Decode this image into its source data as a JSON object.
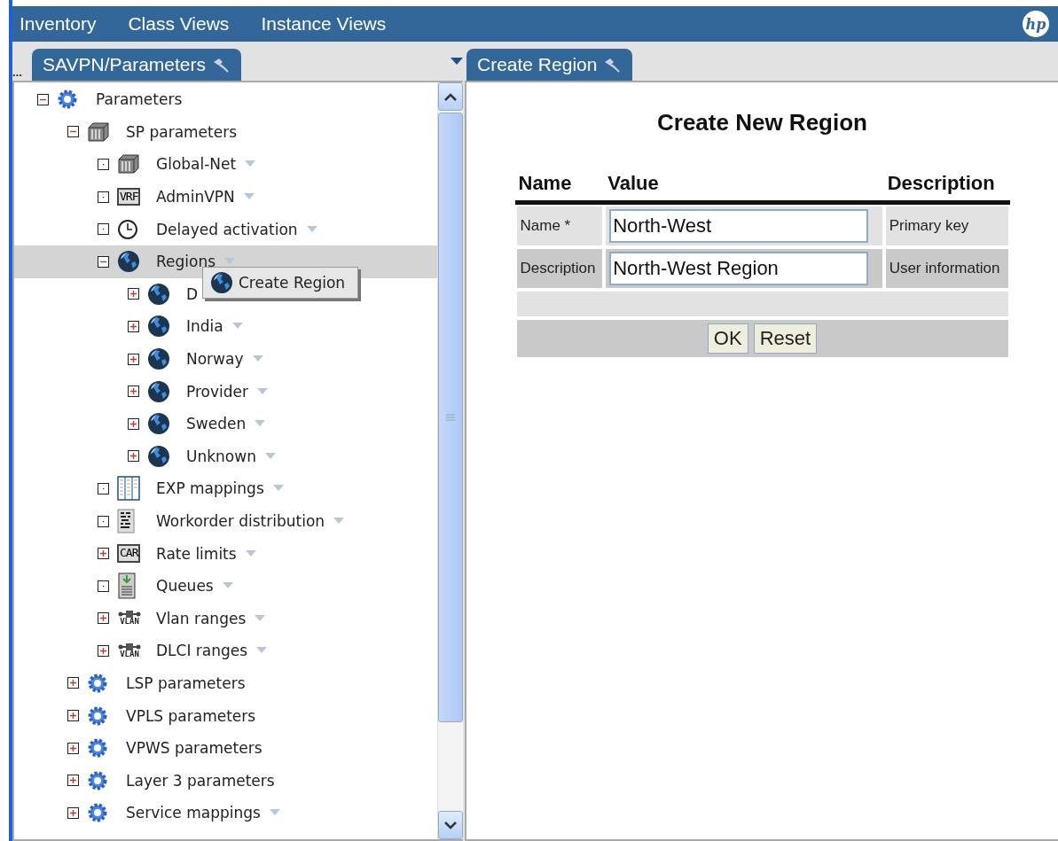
{
  "menu_bar": {
    "items": [
      {
        "label": "Inventory"
      },
      {
        "label": "Class Views"
      },
      {
        "label": "Instance Views"
      }
    ],
    "logo": "hp"
  },
  "left_pane": {
    "overflow_marker": "…",
    "tab": {
      "label": "SAVPN/Parameters",
      "selected": true
    },
    "tree": [
      {
        "label": "Parameters",
        "kind": "gear",
        "expandable": true,
        "expanded": true,
        "menu": false,
        "selected": false,
        "children": [
          {
            "label": "SP parameters",
            "kind": "cube",
            "expandable": true,
            "expanded": true,
            "menu": false,
            "selected": false,
            "children": [
              {
                "label": "Global-Net",
                "kind": "cube",
                "expandable": false,
                "menu": true,
                "selected": false
              },
              {
                "label": "AdminVPN",
                "kind": "tag",
                "icon_text": "VRF",
                "expandable": false,
                "menu": true,
                "selected": false
              },
              {
                "label": "Delayed activation",
                "kind": "clock",
                "expandable": false,
                "menu": true,
                "selected": false
              },
              {
                "label": "Regions",
                "kind": "globe",
                "expandable": true,
                "expanded": true,
                "menu": true,
                "selected": true,
                "children": [
                  {
                    "label": "D",
                    "kind": "globe",
                    "expandable": true,
                    "expanded": false,
                    "menu": false,
                    "selected": false
                  },
                  {
                    "label": "India",
                    "kind": "globe",
                    "expandable": true,
                    "expanded": false,
                    "menu": true,
                    "selected": false
                  },
                  {
                    "label": "Norway",
                    "kind": "globe",
                    "expandable": true,
                    "expanded": false,
                    "menu": true,
                    "selected": false
                  },
                  {
                    "label": "Provider",
                    "kind": "globe",
                    "expandable": true,
                    "expanded": false,
                    "menu": true,
                    "selected": false
                  },
                  {
                    "label": "Sweden",
                    "kind": "globe",
                    "expandable": true,
                    "expanded": false,
                    "menu": true,
                    "selected": false
                  },
                  {
                    "label": "Unknown",
                    "kind": "globe",
                    "expandable": true,
                    "expanded": false,
                    "menu": true,
                    "selected": false
                  }
                ]
              },
              {
                "label": "EXP mappings",
                "kind": "columns",
                "expandable": false,
                "menu": true,
                "selected": false
              },
              {
                "label": "Workorder distribution",
                "kind": "document",
                "expandable": false,
                "menu": true,
                "selected": false
              },
              {
                "label": "Rate limits",
                "kind": "tag",
                "icon_text": "CAR",
                "expandable": true,
                "expanded": false,
                "menu": true,
                "selected": false
              },
              {
                "label": "Queues",
                "kind": "queue",
                "expandable": false,
                "menu": true,
                "selected": false
              },
              {
                "label": "Vlan ranges",
                "kind": "connector",
                "icon_text": "VLAN",
                "expandable": true,
                "expanded": false,
                "menu": true,
                "selected": false
              },
              {
                "label": "DLCI ranges",
                "kind": "connector",
                "icon_text": "VLAN",
                "expandable": true,
                "expanded": false,
                "menu": true,
                "selected": false
              }
            ]
          },
          {
            "label": "LSP parameters",
            "kind": "gear",
            "expandable": true,
            "expanded": false,
            "menu": false,
            "selected": false
          },
          {
            "label": "VPLS parameters",
            "kind": "gear",
            "expandable": true,
            "expanded": false,
            "menu": false,
            "selected": false
          },
          {
            "label": "VPWS parameters",
            "kind": "gear",
            "expandable": true,
            "expanded": false,
            "menu": false,
            "selected": false
          },
          {
            "label": "Layer 3 parameters",
            "kind": "gear",
            "expandable": true,
            "expanded": false,
            "menu": false,
            "selected": false
          },
          {
            "label": "Service mappings",
            "kind": "gear",
            "expandable": true,
            "expanded": false,
            "menu": true,
            "selected": false
          }
        ]
      }
    ],
    "context_menu": {
      "items": [
        {
          "label": "Create Region",
          "kind": "globe"
        }
      ]
    }
  },
  "right_pane": {
    "tab": {
      "label": "Create Region",
      "selected": true
    },
    "form": {
      "title": "Create New Region",
      "columns": [
        "Name",
        "Value",
        "Description"
      ],
      "rows": [
        {
          "name": "Name *",
          "value": "North-West",
          "description": "Primary key"
        },
        {
          "name": "Description",
          "value": "North-West Region",
          "description": "User information"
        }
      ],
      "buttons": [
        "OK",
        "Reset"
      ]
    }
  }
}
